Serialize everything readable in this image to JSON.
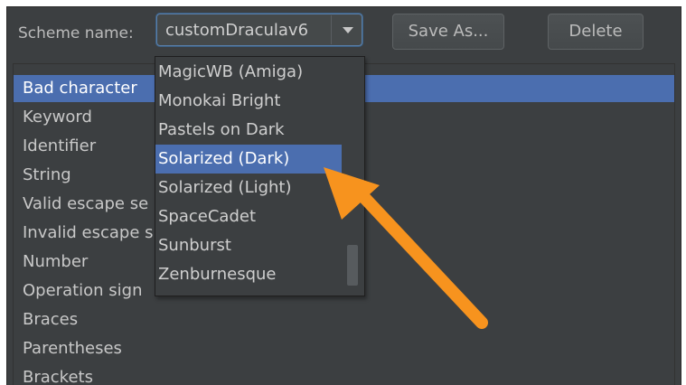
{
  "toolbar": {
    "scheme_label": "Scheme name:",
    "scheme_value": "customDraculav6",
    "save_as_label": "Save As...",
    "delete_label": "Delete"
  },
  "list": {
    "items": [
      {
        "label": "Bad character",
        "selected": true
      },
      {
        "label": "Keyword"
      },
      {
        "label": "Identifier"
      },
      {
        "label": "String"
      },
      {
        "label": "Valid escape se"
      },
      {
        "label": "Invalid escape s"
      },
      {
        "label": "Number"
      },
      {
        "label": "Operation sign"
      },
      {
        "label": "Braces"
      },
      {
        "label": "Parentheses"
      },
      {
        "label": "Brackets"
      }
    ]
  },
  "dropdown": {
    "options": [
      {
        "label": "MagicWB (Amiga)"
      },
      {
        "label": "Monokai Bright"
      },
      {
        "label": "Pastels on Dark"
      },
      {
        "label": "Solarized (Dark)",
        "selected": true
      },
      {
        "label": "Solarized (Light)"
      },
      {
        "label": "SpaceCadet"
      },
      {
        "label": "Sunburst"
      },
      {
        "label": "Zenburnesque"
      }
    ]
  },
  "colors": {
    "selection": "#4b6eaf",
    "background": "#3c3f41",
    "annotation_arrow": "#f7931e"
  },
  "icons": {
    "combo_arrow": "chevron-down-icon",
    "annotation": "callout-arrow-icon"
  }
}
